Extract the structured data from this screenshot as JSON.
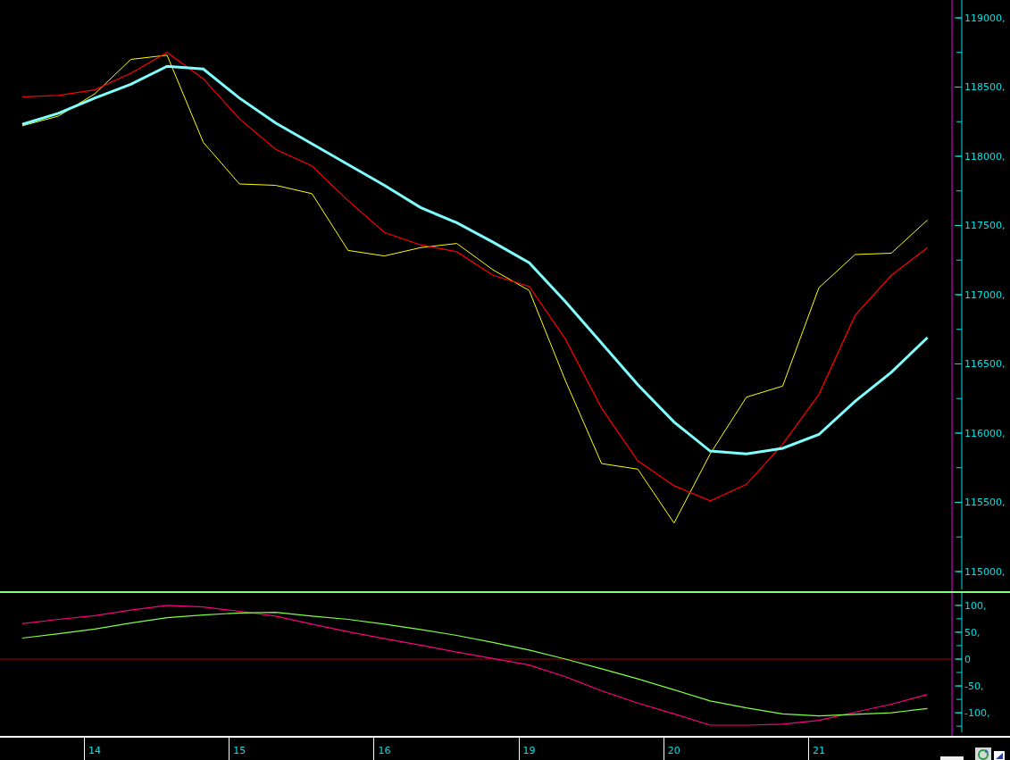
{
  "price_chart": {
    "chart_data": {
      "type": "line",
      "categories": [
        null,
        null,
        null,
        null,
        null,
        null,
        null,
        null,
        null,
        null,
        null,
        null,
        null,
        null,
        null,
        null,
        null,
        null,
        null,
        null,
        null,
        null,
        null,
        null,
        null,
        null
      ],
      "ylim": [
        114845,
        119129
      ],
      "yticks": [
        {
          "value": 119000,
          "label": "119000,"
        },
        {
          "value": 118500,
          "label": "118500,"
        },
        {
          "value": 118000,
          "label": "118000,"
        },
        {
          "value": 117500,
          "label": "117500,"
        },
        {
          "value": 117000,
          "label": "117000,"
        },
        {
          "value": 116500,
          "label": "116500,"
        },
        {
          "value": 116000,
          "label": "116000,"
        },
        {
          "value": 115500,
          "label": "115500,"
        },
        {
          "value": 115000,
          "label": "115000,"
        }
      ],
      "series": [
        {
          "color": "#ffff00",
          "values": [
            118220,
            118290,
            118450,
            118700,
            118730,
            118100,
            117800,
            117790,
            117730,
            117320,
            117280,
            117340,
            117370,
            117180,
            117030,
            116380,
            115780,
            115740,
            115350,
            115850,
            116260,
            116340,
            117050,
            117290,
            117300,
            117540
          ]
        },
        {
          "color": "#ff0000",
          "values": [
            118430,
            118440,
            118480,
            118600,
            118750,
            118560,
            118270,
            118050,
            117930,
            117680,
            117450,
            117360,
            117310,
            117140,
            117060,
            116680,
            116180,
            115800,
            115620,
            115510,
            115630,
            115920,
            116280,
            116850,
            117140,
            117340
          ]
        },
        {
          "color": "#80ffff",
          "values": [
            118230,
            118310,
            118420,
            118520,
            118650,
            118630,
            118420,
            118240,
            118090,
            117940,
            117790,
            117630,
            117520,
            117380,
            117230,
            116950,
            116650,
            116350,
            116080,
            115870,
            115850,
            115890,
            115990,
            116230,
            116440,
            116690
          ]
        }
      ]
    }
  },
  "oscillator": {
    "chart_data": {
      "type": "line",
      "categories": [
        null,
        null,
        "14",
        null,
        null,
        null,
        "15",
        null,
        null,
        null,
        "16",
        null,
        null,
        null,
        "19",
        null,
        null,
        null,
        "20",
        null,
        null,
        null,
        "21",
        null,
        null,
        null
      ],
      "ylim": [
        -143,
        123
      ],
      "yticks": [
        {
          "value": 100,
          "label": "100,"
        },
        {
          "value": 50,
          "label": "50,"
        },
        {
          "value": 0,
          "label": "0"
        },
        {
          "value": -50,
          "label": "-50,"
        },
        {
          "value": -100,
          "label": "-100,"
        }
      ],
      "ref_lines": [
        {
          "axis": "y",
          "value": 0,
          "color": "#a00000"
        }
      ],
      "series": [
        {
          "color": "#ff0080",
          "values": [
            66,
            74,
            81,
            91,
            100,
            97,
            89,
            80,
            65,
            51,
            38,
            26,
            13,
            1,
            -11,
            -33,
            -59,
            -82,
            -102,
            -123,
            -123,
            -121,
            -114,
            -99,
            -84,
            -66
          ]
        },
        {
          "color": "#80ff40",
          "values": [
            39,
            47,
            56,
            67,
            77,
            82,
            86,
            87,
            80,
            74,
            65,
            55,
            44,
            31,
            17,
            0,
            -18,
            -37,
            -57,
            -78,
            -91,
            -102,
            -106,
            -103,
            -100,
            -92
          ]
        }
      ]
    }
  }
}
